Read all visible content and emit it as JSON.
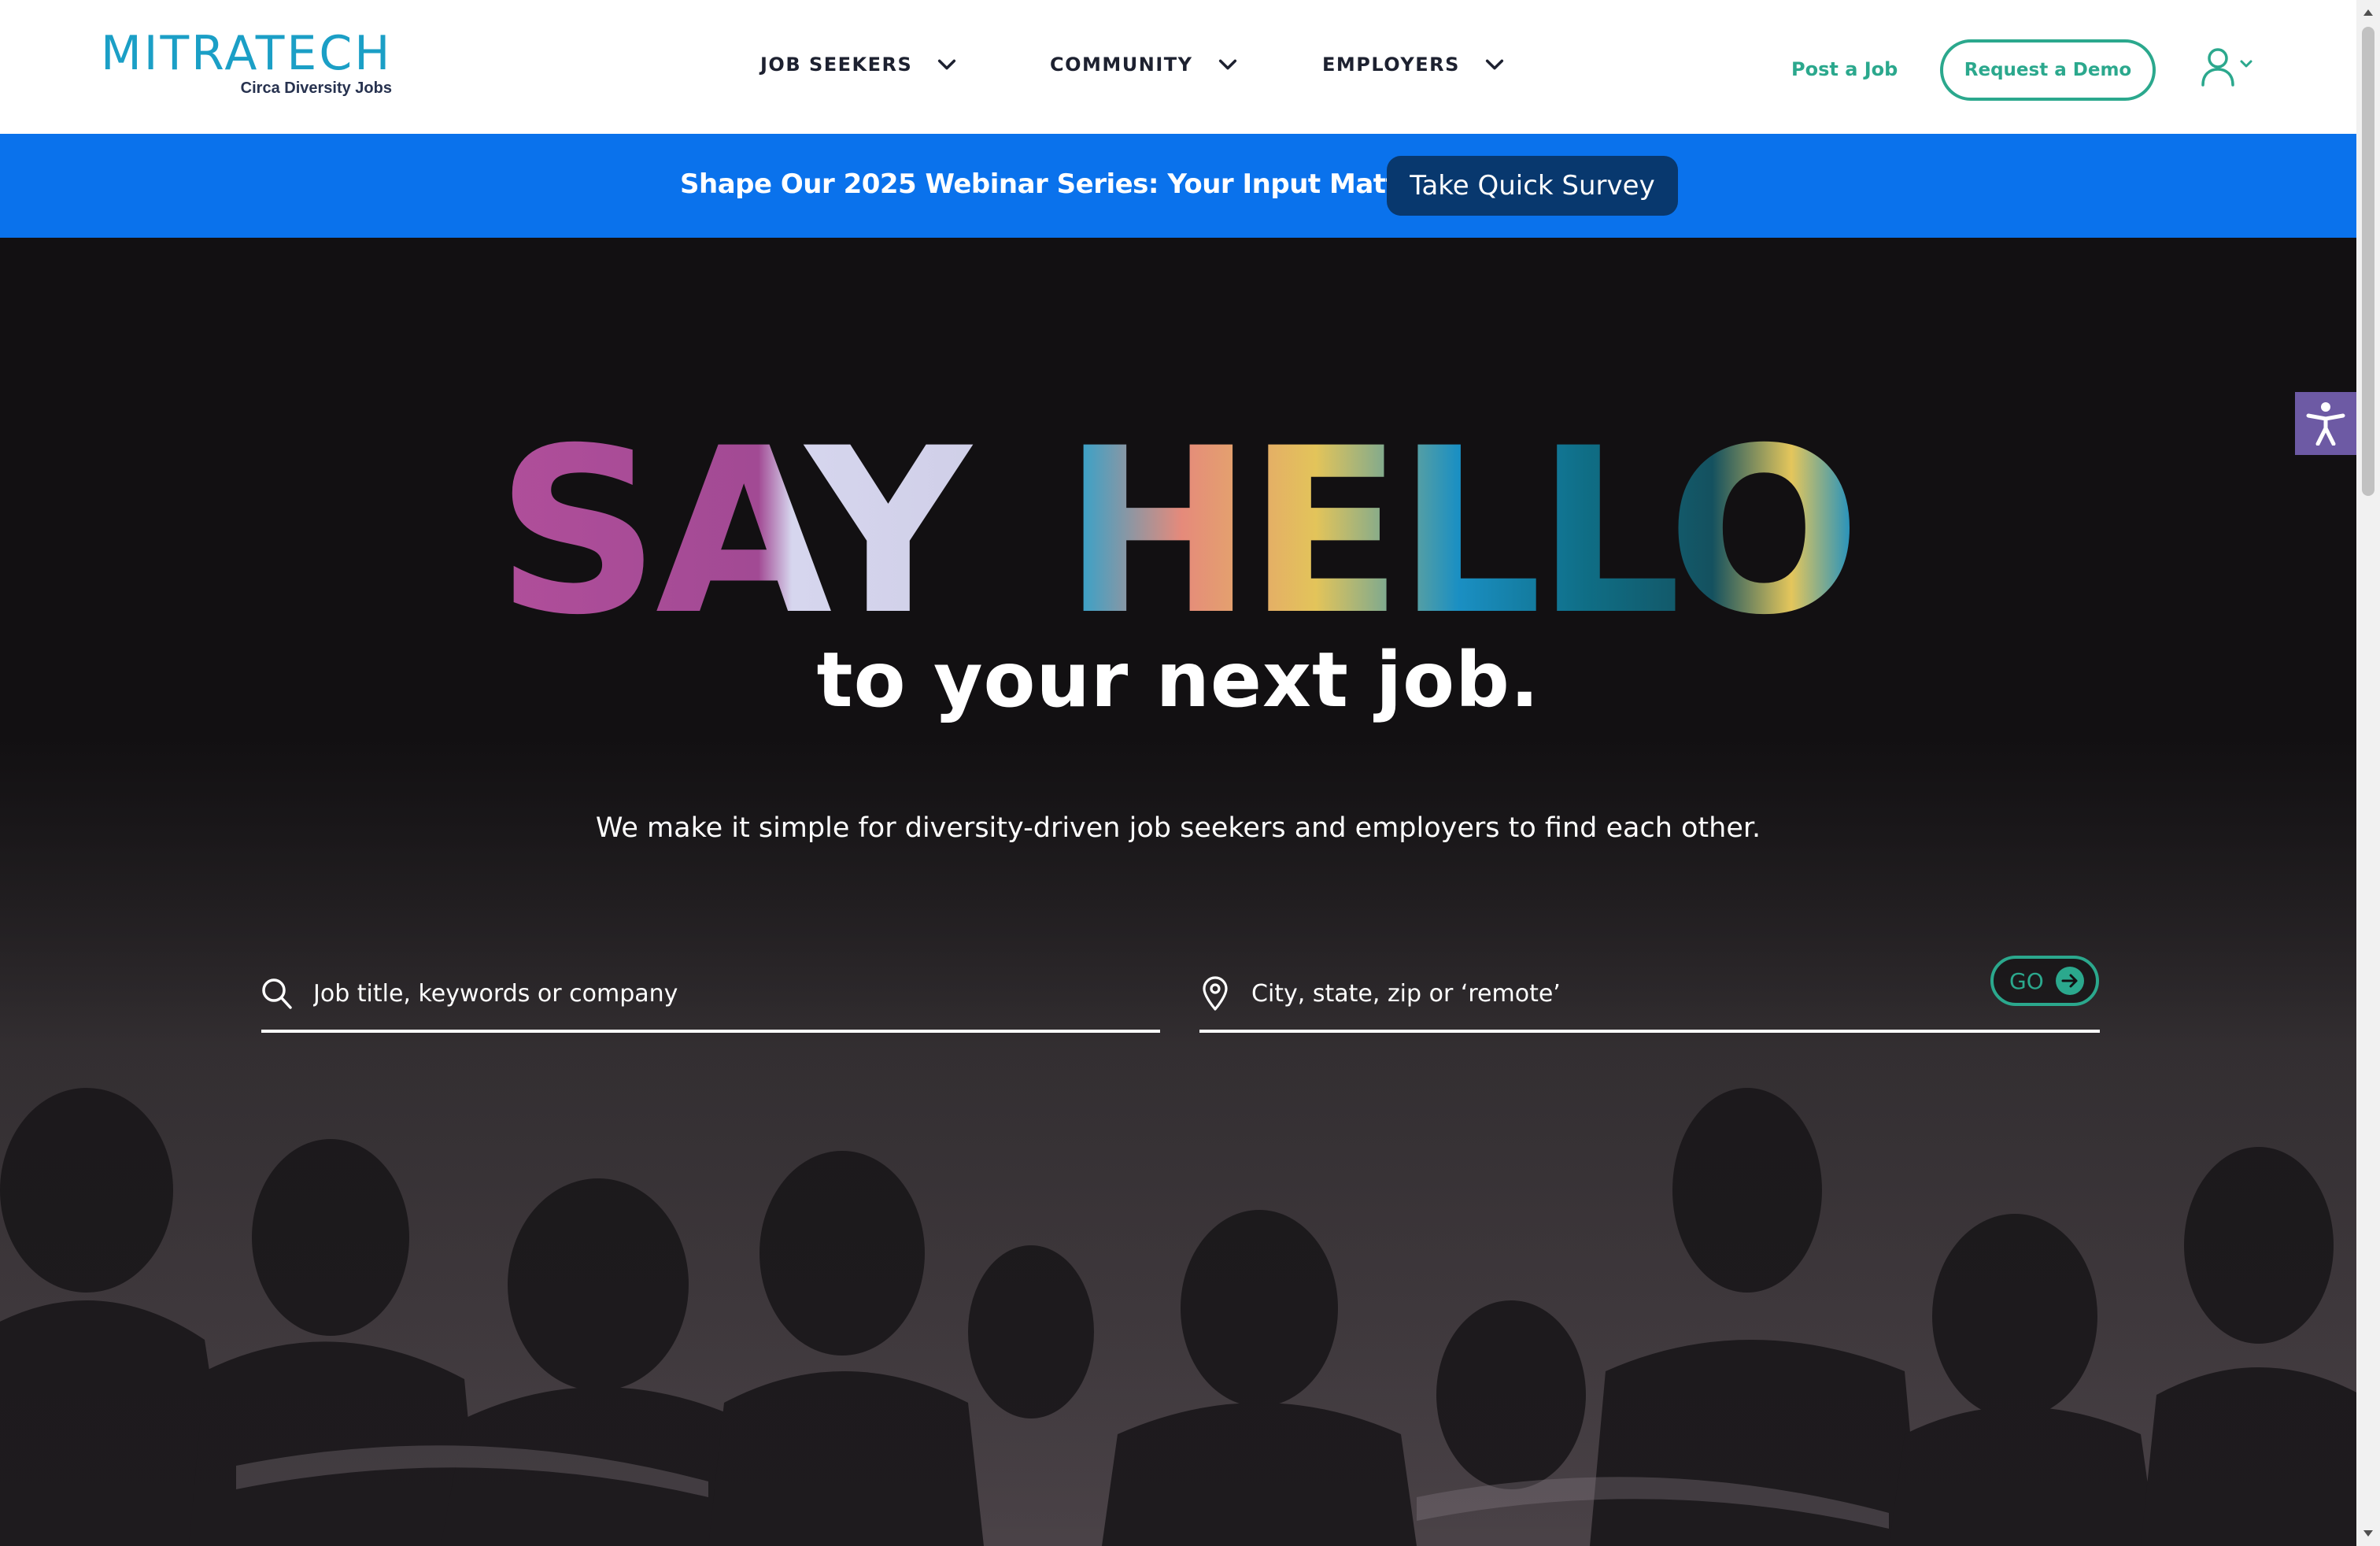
{
  "header": {
    "logo_main": "MITRATECH",
    "logo_sub": "Circa Diversity Jobs",
    "nav": [
      {
        "label": "JOB SEEKERS"
      },
      {
        "label": "COMMUNITY"
      },
      {
        "label": "EMPLOYERS"
      }
    ],
    "post_job_label": "Post a Job",
    "demo_label": "Request a Demo"
  },
  "banner": {
    "text": "Shape Our 2025 Webinar Series: Your Input Matters!",
    "button_label": "Take Quick Survey"
  },
  "hero": {
    "title_word1": "SAY",
    "title_word2": "HELLO",
    "subtitle": "to your next job.",
    "description": "We make it simple for diversity-driven job seekers and employers to find each other.",
    "keyword_placeholder": "Job title, keywords or company",
    "location_placeholder": "City, state, zip or ‘remote’",
    "go_label": "GO"
  },
  "colors": {
    "brand_teal": "#2ba88d",
    "logo_blue": "#1b9fc6",
    "banner_blue": "#0a72ec",
    "survey_button": "#08386e",
    "hero_bg": "#121012",
    "a11y_purple": "#6d5aa4"
  },
  "icons": {
    "nav_chevron": "chevron-down-icon",
    "user": "user-icon",
    "search": "search-icon",
    "location": "map-pin-icon",
    "go": "arrow-right-circle-icon",
    "accessibility": "accessibility-icon"
  }
}
